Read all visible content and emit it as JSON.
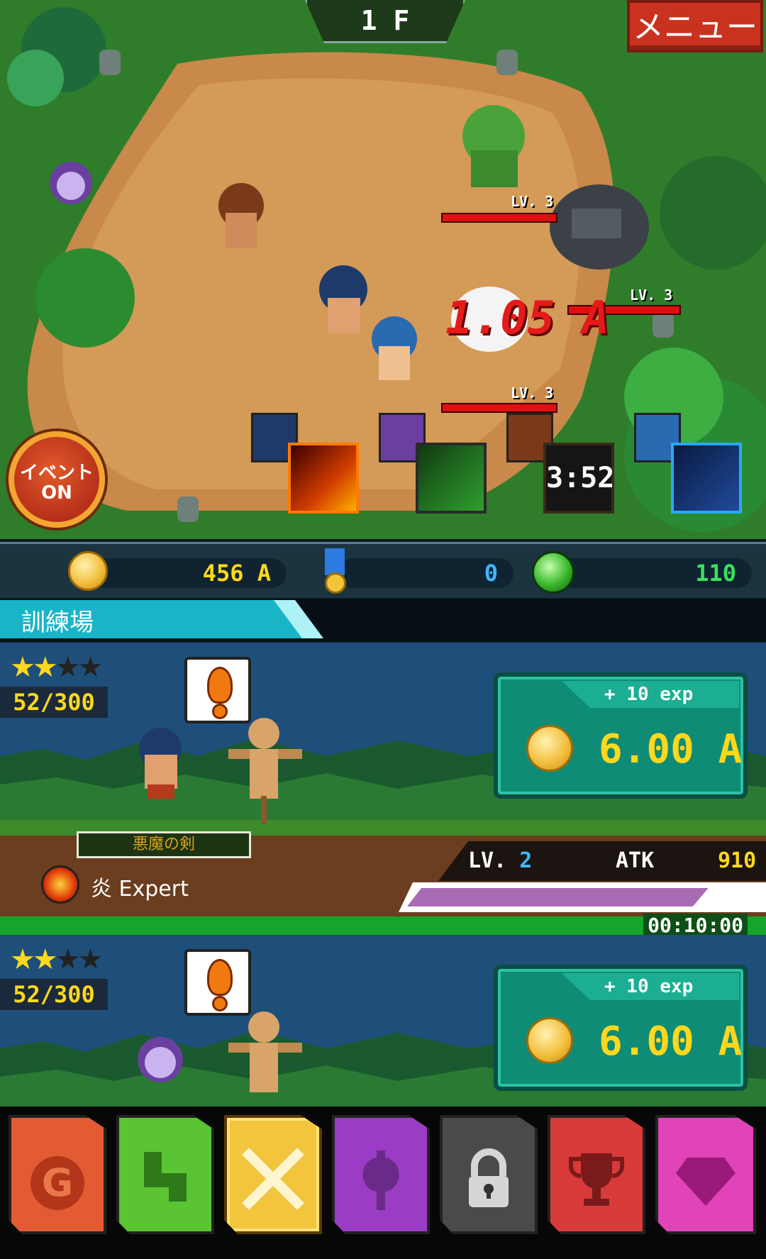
{
  "battle": {
    "floor": "1 F",
    "menu_label": "メニュー",
    "event_line1": "イベント",
    "event_line2": "ON",
    "damage_text": "1.05 A",
    "enemy_levels": [
      "LV. 3",
      "LV. 3",
      "LV. 3"
    ],
    "skill_timer": "3:52"
  },
  "resources": {
    "gold": "456 A",
    "medals": "0",
    "gems": "110"
  },
  "section": {
    "title": "訓練場"
  },
  "training": [
    {
      "stars_filled": 2,
      "stars_total": 4,
      "exp_count": "52/300",
      "exp_reward": "+ 10 exp",
      "cost": "6.00 A",
      "weapon": "悪魔の剣",
      "element_label": "炎 Expert",
      "lv_label": "LV.",
      "lv_value": "2",
      "atk_label": "ATK",
      "atk_value": "910",
      "timer": "00:10:00",
      "progress": 0.82
    },
    {
      "stars_filled": 2,
      "stars_total": 4,
      "exp_count": "52/300",
      "exp_reward": "+ 10 exp",
      "cost": "6.00 A"
    }
  ],
  "nav": {
    "colors": [
      "#e35b33",
      "#5bc433",
      "#f2c53d",
      "#9b3cc4",
      "#4a4a4a",
      "#d83a3a",
      "#e044b8"
    ],
    "icons": [
      "gold-g-icon",
      "map-icon",
      "crossed-swords-icon",
      "battle-axe-icon",
      "padlock-icon",
      "trophy-icon",
      "gem-icon"
    ],
    "gold_glyph": "G"
  }
}
